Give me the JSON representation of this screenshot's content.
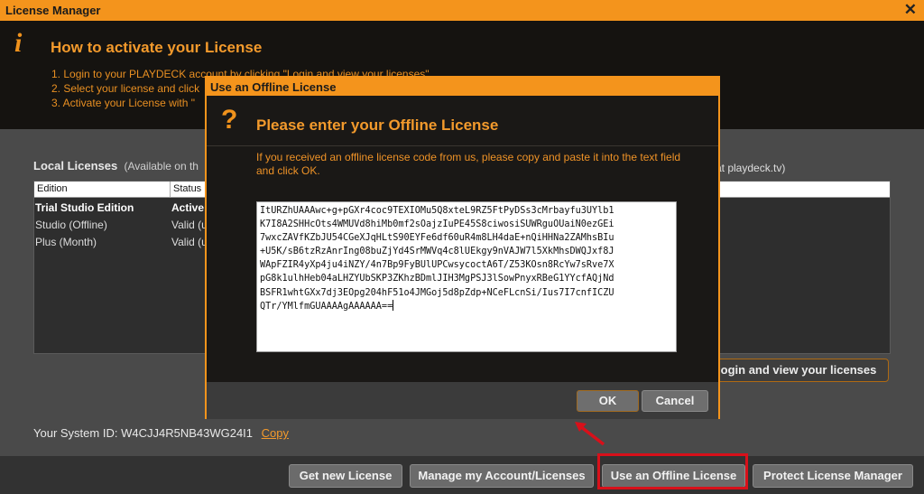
{
  "window": {
    "title": "License Manager",
    "close": "✕"
  },
  "info": {
    "icon": "i",
    "heading": "How to activate your License",
    "steps": [
      "1. Login to your PLAYDECK account by clicking \"Login and view your licenses\"",
      "2. Select your license and click",
      "3. Activate your License with \""
    ]
  },
  "local": {
    "title": "Local Licenses",
    "subtitle": "(Available on th",
    "right_text": "at playdeck.tv)",
    "columns": [
      "Edition",
      "Status"
    ],
    "rows": [
      {
        "edition": "Trial Studio Edition",
        "status": "Active"
      },
      {
        "edition": "Studio (Offline)",
        "status": "Valid (u"
      },
      {
        "edition": "Plus (Month)",
        "status": "Valid (u"
      }
    ]
  },
  "login_button": "ogin and view your licenses",
  "system": {
    "label": "Your System ID:",
    "id": "W4CJJ4R5NB43WG24I1",
    "copy": "Copy"
  },
  "bottom_buttons": [
    "Get new License",
    "Manage my Account/Licenses",
    "Use an Offline License",
    "Protect License Manager"
  ],
  "dialog": {
    "title": "Use an Offline License",
    "icon": "?",
    "heading": "Please enter your Offline License",
    "description": "If you received an offline license code from us, please copy and paste it into the text field and click OK.",
    "license_lines": [
      "ItURZhUAAAwc+g+pGXr4coc9TEXIOMu5Q8xteL9RZ5FtPyDSs3cMrbayfu3UYlb1",
      "K7I8A2SHHcOts4WMUVd8hiMb0mf2sOajzIuPE45S8ciwosiSUWRguOUaiN0ezGEi",
      "7wxcZAVfKZbJU54CGeXJqHLtS90EYFe6df60uR4m8LH4daE+nQiHHNa2ZAMhsBIu",
      "+U5K/sB6tzRzAnrIng08buZjYd4SrMWVq4c8lUEkgy9nVAJW7l5XkMhsDWQJxf8J",
      "WApFZIR4yXp4ju4iNZY/4n7Bp9FyBUlUPCwsycoctA6T/Z53KOsn8RcYw7sRve7X",
      "pG8k1ulhHeb04aLHZYUbSKP3ZKhzBDmlJIH3MgPSJ3lSowPnyxRBeG1YYcfAQjNd",
      "BSFR1whtGXx7dj3EOpg204hF51o4JMGoj5d8pZdp+NCeFLcnSi/Ius7I7cnfICZU",
      "QTr/YMlfmGUAAAAgAAAAAA=="
    ],
    "ok": "OK",
    "cancel": "Cancel"
  },
  "colors": {
    "accent": "#f4941c",
    "highlight": "#d8101a"
  }
}
